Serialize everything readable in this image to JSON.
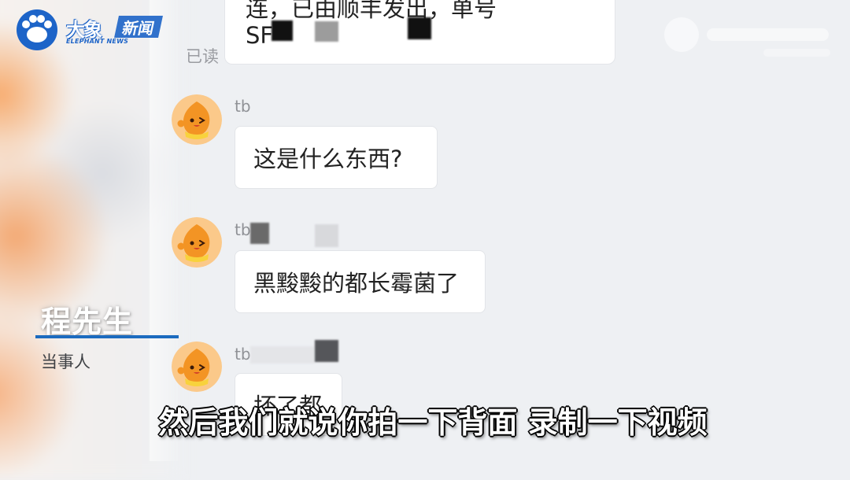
{
  "brand": {
    "logo_cn_main": "大象",
    "logo_cn_tag": "新闻",
    "logo_en": "ELEPHANT NEWS"
  },
  "chat": {
    "previous_message": {
      "line1": "连，已由顺丰发出，单号",
      "line2": "SF"
    },
    "read_status": "已读",
    "messages": [
      {
        "sender": "tb",
        "text": "这是什么东西?"
      },
      {
        "sender": "tb",
        "text": "黑黢黢的都长霉菌了"
      },
      {
        "sender": "tb",
        "text": "坏了都"
      }
    ]
  },
  "caption": {
    "name": "程先生",
    "role": "当事人"
  },
  "subtitle": {
    "text": "然后我们就说你拍一下背面 录制一下视频"
  },
  "icons": {
    "logo": "elephant-paw-icon",
    "avatar": "orange-peach-avatar-icon"
  },
  "colors": {
    "brand_blue": "#1d64c8",
    "caption_line": "#1c6bbf",
    "chat_background": "#eef0f3",
    "bubble": "#ffffff",
    "meta_text": "#9a9ca1",
    "avatar_orange": "#f39424"
  }
}
